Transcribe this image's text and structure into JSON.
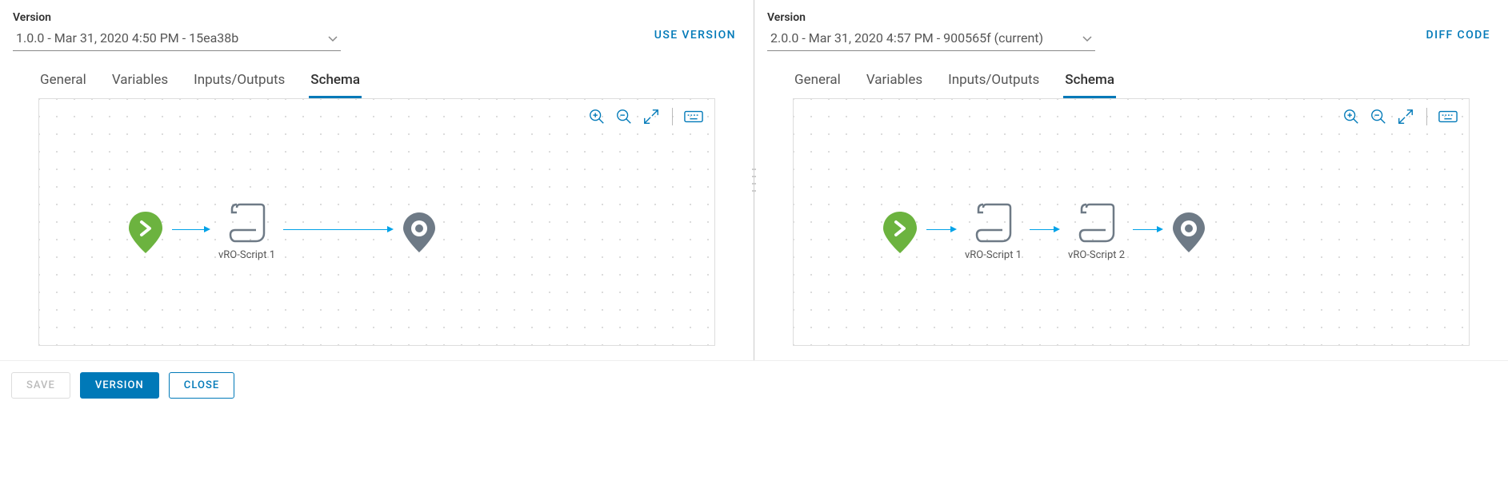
{
  "left": {
    "label": "Version",
    "value": "1.0.0 - Mar 31, 2020 4:50 PM - 15ea38b",
    "action": "USE VERSION",
    "tabs": [
      "General",
      "Variables",
      "Inputs/Outputs",
      "Schema"
    ],
    "activeTab": "Schema",
    "nodes": [
      {
        "type": "start",
        "label": ""
      },
      {
        "type": "script",
        "label": "vRO-Script 1"
      },
      {
        "type": "end",
        "label": ""
      }
    ]
  },
  "right": {
    "label": "Version",
    "value": "2.0.0 - Mar 31, 2020 4:57 PM - 900565f (current)",
    "action": "DIFF CODE",
    "tabs": [
      "General",
      "Variables",
      "Inputs/Outputs",
      "Schema"
    ],
    "activeTab": "Schema",
    "nodes": [
      {
        "type": "start",
        "label": ""
      },
      {
        "type": "script",
        "label": "vRO-Script 1"
      },
      {
        "type": "script",
        "label": "vRO-Script 2"
      },
      {
        "type": "end",
        "label": ""
      }
    ]
  },
  "toolbar": {
    "zoomIn": "zoom-in",
    "zoomOut": "zoom-out",
    "fit": "fit-screen",
    "keyboard": "keyboard"
  },
  "footer": {
    "save": "SAVE",
    "version": "VERSION",
    "close": "CLOSE"
  },
  "colors": {
    "accent": "#0079b8",
    "start": "#62a40d",
    "node": "#6e7a86"
  }
}
